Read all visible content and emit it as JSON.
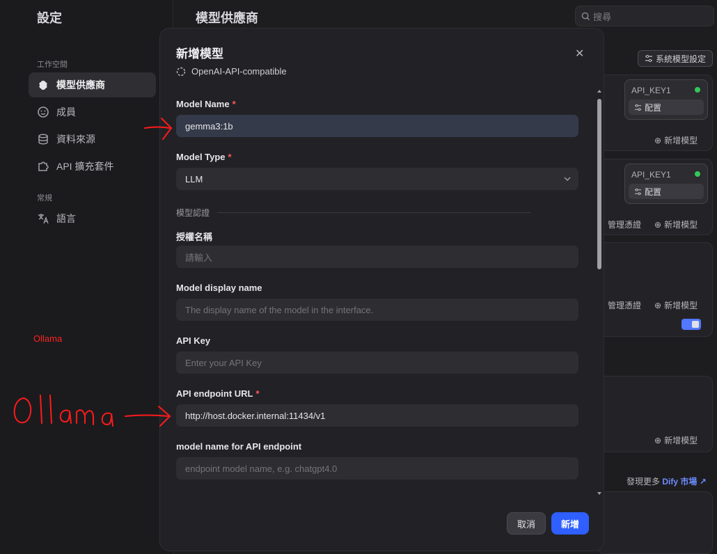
{
  "sidebar": {
    "title": "設定",
    "workspace_label": "工作空間",
    "general_label": "常規",
    "items": [
      {
        "label": "模型供應商",
        "active": true
      },
      {
        "label": "成員"
      },
      {
        "label": "資料來源"
      },
      {
        "label": "API 擴充套件"
      }
    ],
    "general_items": [
      {
        "label": "語言"
      }
    ]
  },
  "main": {
    "title": "模型供應商",
    "search_placeholder": "搜尋",
    "system_model_button": "系統模型設定",
    "cards": [
      {
        "key_label": "API_KEY1",
        "config_label": "配置",
        "add_model": "新增模型"
      },
      {
        "key_label": "API_KEY1",
        "config_label": "配置",
        "manage": "管理憑證",
        "add_model": "新增模型"
      },
      {
        "manage": "管理憑證",
        "add_model": "新增模型"
      },
      {
        "add_model": "新增模型"
      }
    ],
    "discover_text": "發現更多",
    "discover_link": "Dify 市場 ↗"
  },
  "modal": {
    "title": "新增模型",
    "provider": "OpenAI-API-compatible",
    "fields": {
      "model_name": {
        "label": "Model Name",
        "value": "gemma3:1b"
      },
      "model_type": {
        "label": "Model Type",
        "value": "LLM"
      },
      "section": "模型認證",
      "auth_name": {
        "label": "授權名稱",
        "placeholder": "請輸入"
      },
      "display_name": {
        "label": "Model display name",
        "placeholder": "The display name of the model in the interface."
      },
      "api_key": {
        "label": "API Key",
        "placeholder": "Enter your API Key"
      },
      "endpoint_url": {
        "label": "API endpoint URL",
        "value": "http://host.docker.internal:11434/v1"
      },
      "endpoint_model": {
        "label": "model name for API endpoint",
        "placeholder": "endpoint model name, e.g. chatgpt4.0"
      }
    },
    "cancel": "取消",
    "submit": "新增"
  },
  "annotations": {
    "ollama_small": "Ollama",
    "ollama_handwritten": "Ollama"
  },
  "colors": {
    "accent": "#2f5fff",
    "annotation": "#ff2020",
    "status": "#34c759"
  }
}
